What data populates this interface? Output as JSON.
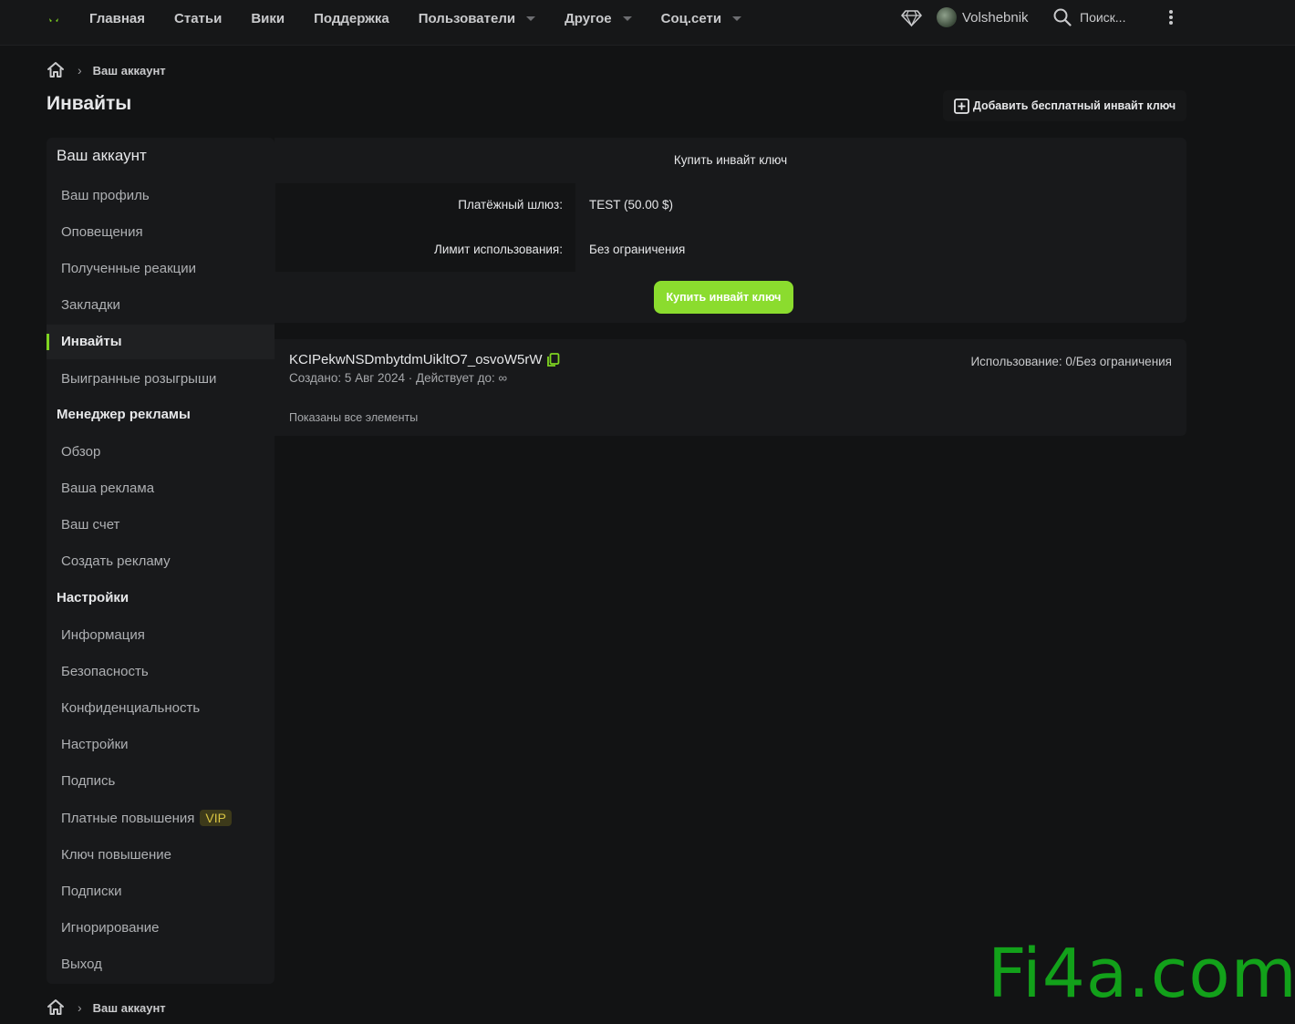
{
  "nav": {
    "items": [
      {
        "label": "Главная",
        "dropdown": false
      },
      {
        "label": "Статьи",
        "dropdown": false
      },
      {
        "label": "Вики",
        "dropdown": false
      },
      {
        "label": "Поддержка",
        "dropdown": false
      },
      {
        "label": "Пользователи",
        "dropdown": true
      },
      {
        "label": "Другое",
        "dropdown": true
      },
      {
        "label": "Соц.сети",
        "dropdown": true
      }
    ],
    "username": "Volshebnik",
    "search_label": "Поиск..."
  },
  "breadcrumb": {
    "current": "Ваш аккаунт"
  },
  "page": {
    "title": "Инвайты",
    "add_button": "Добавить бесплатный инвайт ключ"
  },
  "sidebar": {
    "header": "Ваш аккаунт",
    "account_items": [
      "Ваш профиль",
      "Оповещения",
      "Полученные реакции",
      "Закладки",
      "Инвайты",
      "Выигранные розыгрыши"
    ],
    "ads_section": "Менеджер рекламы",
    "ads_items": [
      "Обзор",
      "Ваша реклама",
      "Ваш счет",
      "Создать рекламу"
    ],
    "settings_section": "Настройки",
    "settings_items": [
      "Информация",
      "Безопасность",
      "Конфиденциальность",
      "Настройки",
      "Подпись",
      "Платные повышения",
      "Ключ повышение",
      "Подписки",
      "Игнорирование",
      "Выход"
    ],
    "vip_badge": "VIP",
    "active": "Инвайты"
  },
  "buy": {
    "title": "Купить инвайт ключ",
    "gateway_label": "Платёжный шлюз:",
    "gateway_value": "TEST (50.00 $)",
    "limit_label": "Лимит использования:",
    "limit_value": "Без ограничения",
    "button": "Купить инвайт ключ"
  },
  "invites": {
    "key": "KCIPekwNSDmbytdmUikltO7_osvoW5rW",
    "meta": "Создано: 5 Авг 2024 · Действует до: ∞",
    "usage": "Использование: 0/Без ограничения",
    "footer": "Показаны все элементы"
  },
  "watermark": "Fi4a.com",
  "colors": {
    "accent": "#8bdc2e",
    "background": "#121314",
    "panel": "#18191b",
    "watermark": "#12a11a"
  }
}
